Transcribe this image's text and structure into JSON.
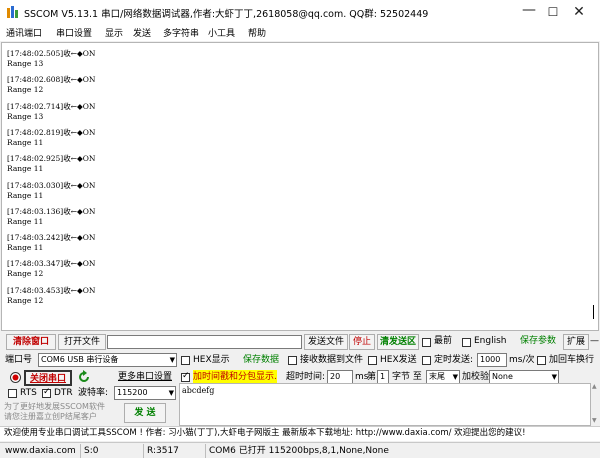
{
  "window": {
    "title": "SSCOM V5.13.1 串口/网络数据调试器,作者:大虾丁丁,2618058@qq.com. QQ群: 52502449",
    "min_glyph": "—",
    "max_glyph": "☐",
    "close_glyph": "✕"
  },
  "menu": [
    "通讯端口",
    "串口设置",
    "显示",
    "发送",
    "多字符串",
    "小工具",
    "帮助"
  ],
  "receive_log": [
    {
      "time": "[17:48:02.505]收←◆ON",
      "value": "Range 13"
    },
    {
      "time": "[17:48:02.608]收←◆ON",
      "value": "Range 12"
    },
    {
      "time": "[17:48:02.714]收←◆ON",
      "value": "Range 13"
    },
    {
      "time": "[17:48:02.819]收←◆ON",
      "value": "Range 11"
    },
    {
      "time": "[17:48:02.925]收←◆ON",
      "value": "Range 11"
    },
    {
      "time": "[17:48:03.030]收←◆ON",
      "value": "Range 11"
    },
    {
      "time": "[17:48:03.136]收←◆ON",
      "value": "Range 11"
    },
    {
      "time": "[17:48:03.242]收←◆ON",
      "value": "Range 11"
    },
    {
      "time": "[17:48:03.347]收←◆ON",
      "value": "Range 12"
    },
    {
      "time": "[17:48:03.453]收←◆ON",
      "value": "Range 12"
    }
  ],
  "row1": {
    "clear_window": "清除窗口",
    "open_file": "打开文件",
    "send_file": "发送文件",
    "stop": "停止",
    "clear_send_area": "清发送区",
    "topmost": "最前",
    "english": "English",
    "save_params": "保存参数",
    "expand": "扩展",
    "collapse": "—"
  },
  "row2": {
    "port_label": "端口号",
    "port_value": "COM6 USB 串行设备",
    "hex_display": "HEX显示",
    "save_data": "保存数据",
    "receive_to_file": "接收数据到文件",
    "hex_send": "HEX发送",
    "timed_send": "定时发送:",
    "interval_value": "1000",
    "interval_unit": "ms/次",
    "append_newline": "加回车换行"
  },
  "row3": {
    "close_port": "关闭串口",
    "more_settings": "更多串口设置",
    "timestamp_split": "加时间戳和分包显示.",
    "timeout_label": "超时时间:",
    "timeout_value": "20",
    "timeout_unit": "ms",
    "nth_label": "第",
    "nth_value": "1",
    "byte_label": "字节 至",
    "end_value": "末尾",
    "checksum_label": "加校验",
    "checksum_value": "None"
  },
  "row4": {
    "rts": "RTS",
    "dtr": "DTR",
    "baud_label": "波特率:",
    "baud_value": "115200"
  },
  "tx": {
    "text": "abcdefg",
    "hint_line1": "为了更好地发展SSCOM软件",
    "hint_line2": "请您注册嘉立创P结尾客户",
    "send_button": "发 送"
  },
  "promo": "欢迎使用专业串口调试工具SSCOM !  作者: 习小猫(丁丁),大虾电子网版主  最新版本下载地址: http://www.daxia.com/  欢迎提出您的建议!",
  "status": {
    "website": "www.daxia.com",
    "sent": "S:0",
    "received": "R:3517",
    "port_state": "COM6 已打开  115200bps,8,1,None,None"
  },
  "colors": {
    "accent_red": "#c00000",
    "accent_green": "#008000"
  }
}
